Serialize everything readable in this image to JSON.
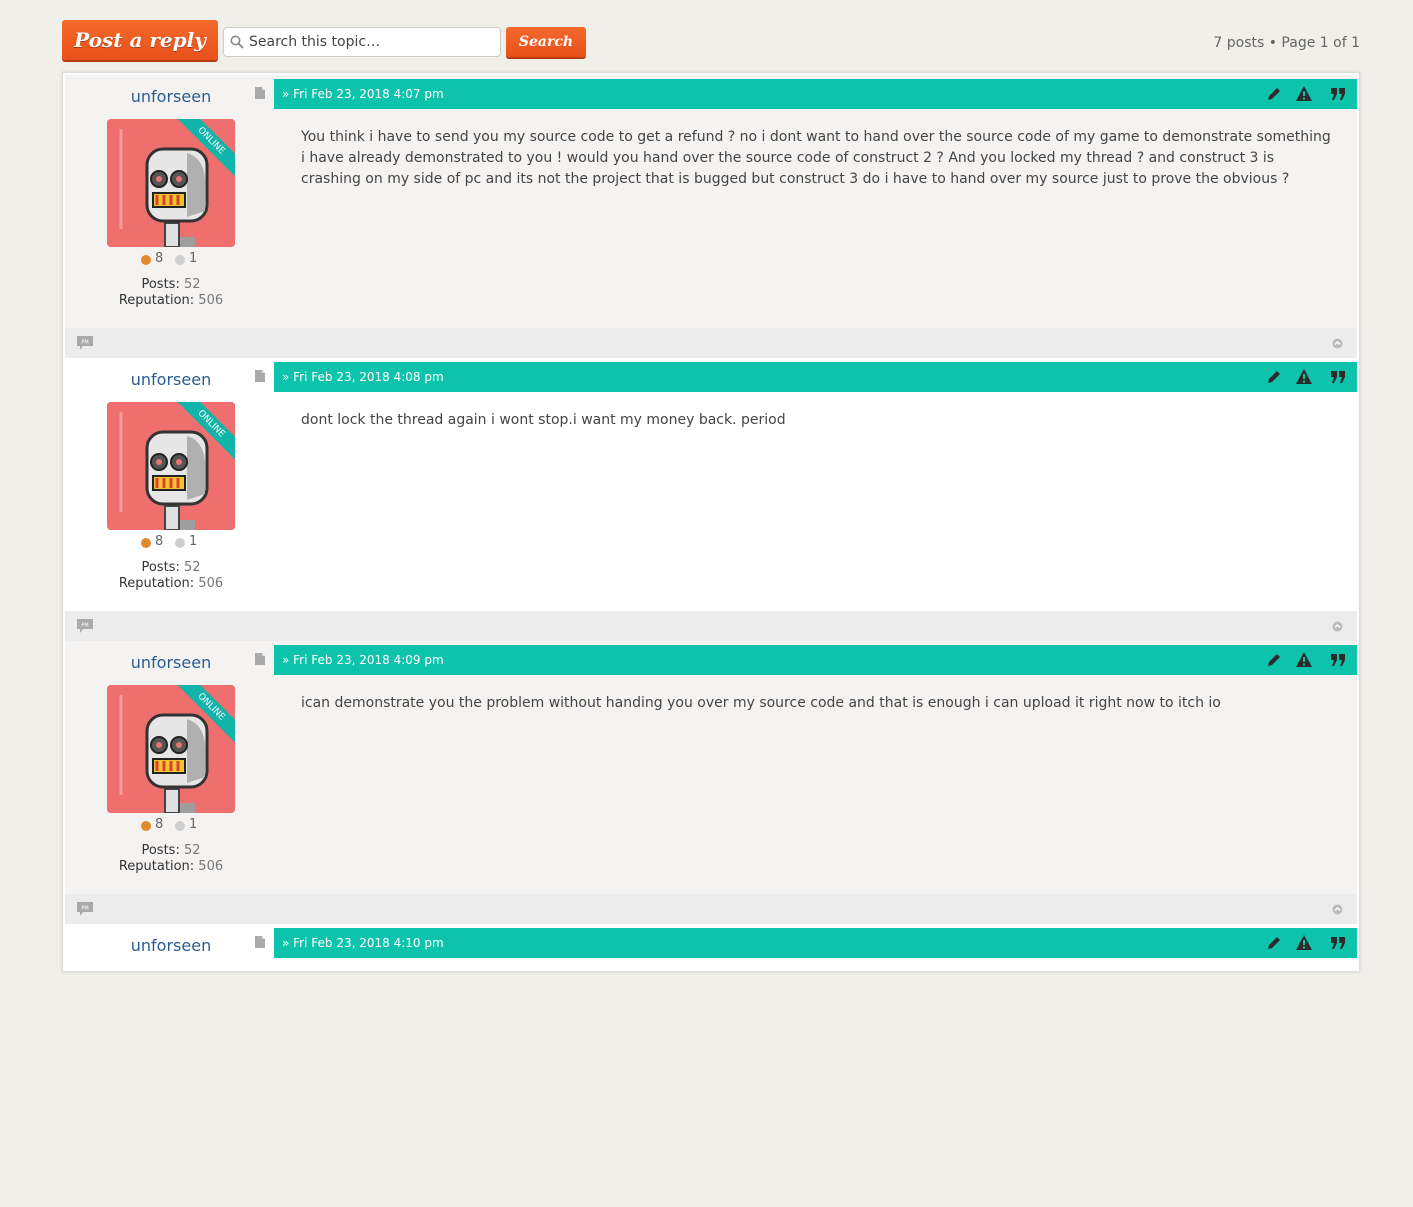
{
  "toolbar": {
    "post_reply_label": "Post a reply",
    "search_placeholder": "Search this topic…",
    "search_button_label": "Search",
    "pagination_text": "7 posts • Page 1 of 1"
  },
  "colors": {
    "accent_orange": "#ec5a20",
    "post_bar_teal": "#0ec3ab",
    "avatar_bg": "#ef6e6e",
    "username_blue": "#2a5d8f"
  },
  "posts": [
    {
      "author": "unforseen",
      "online_label": "ONLINE",
      "medal_gold": "8",
      "medal_silver": "1",
      "posts_label": "Posts:",
      "posts_value": "52",
      "reputation_label": "Reputation:",
      "reputation_value": "506",
      "date": "» Fri Feb 23, 2018 4:07 pm",
      "content": "You think i have to send you my source code to get a refund ? no i dont want to hand over the source code of my game to demonstrate something i have already demonstrated to you ! would you hand over the source code of construct 2 ? And you locked my thread ? and construct 3 is crashing on my side of pc and its not the project that is bugged but construct 3 do i have to hand over my source just to prove the obvious ?",
      "pm_label": "PM"
    },
    {
      "author": "unforseen",
      "online_label": "ONLINE",
      "medal_gold": "8",
      "medal_silver": "1",
      "posts_label": "Posts:",
      "posts_value": "52",
      "reputation_label": "Reputation:",
      "reputation_value": "506",
      "date": "» Fri Feb 23, 2018 4:08 pm",
      "content": "dont lock the thread again i wont stop.i want my money back. period",
      "pm_label": "PM"
    },
    {
      "author": "unforseen",
      "online_label": "ONLINE",
      "medal_gold": "8",
      "medal_silver": "1",
      "posts_label": "Posts:",
      "posts_value": "52",
      "reputation_label": "Reputation:",
      "reputation_value": "506",
      "date": "» Fri Feb 23, 2018 4:09 pm",
      "content": "ican demonstrate you the problem without handing you over my source code and that is enough i can upload it right now to itch io",
      "pm_label": "PM"
    },
    {
      "author": "unforseen",
      "date": "» Fri Feb 23, 2018 4:10 pm"
    }
  ]
}
